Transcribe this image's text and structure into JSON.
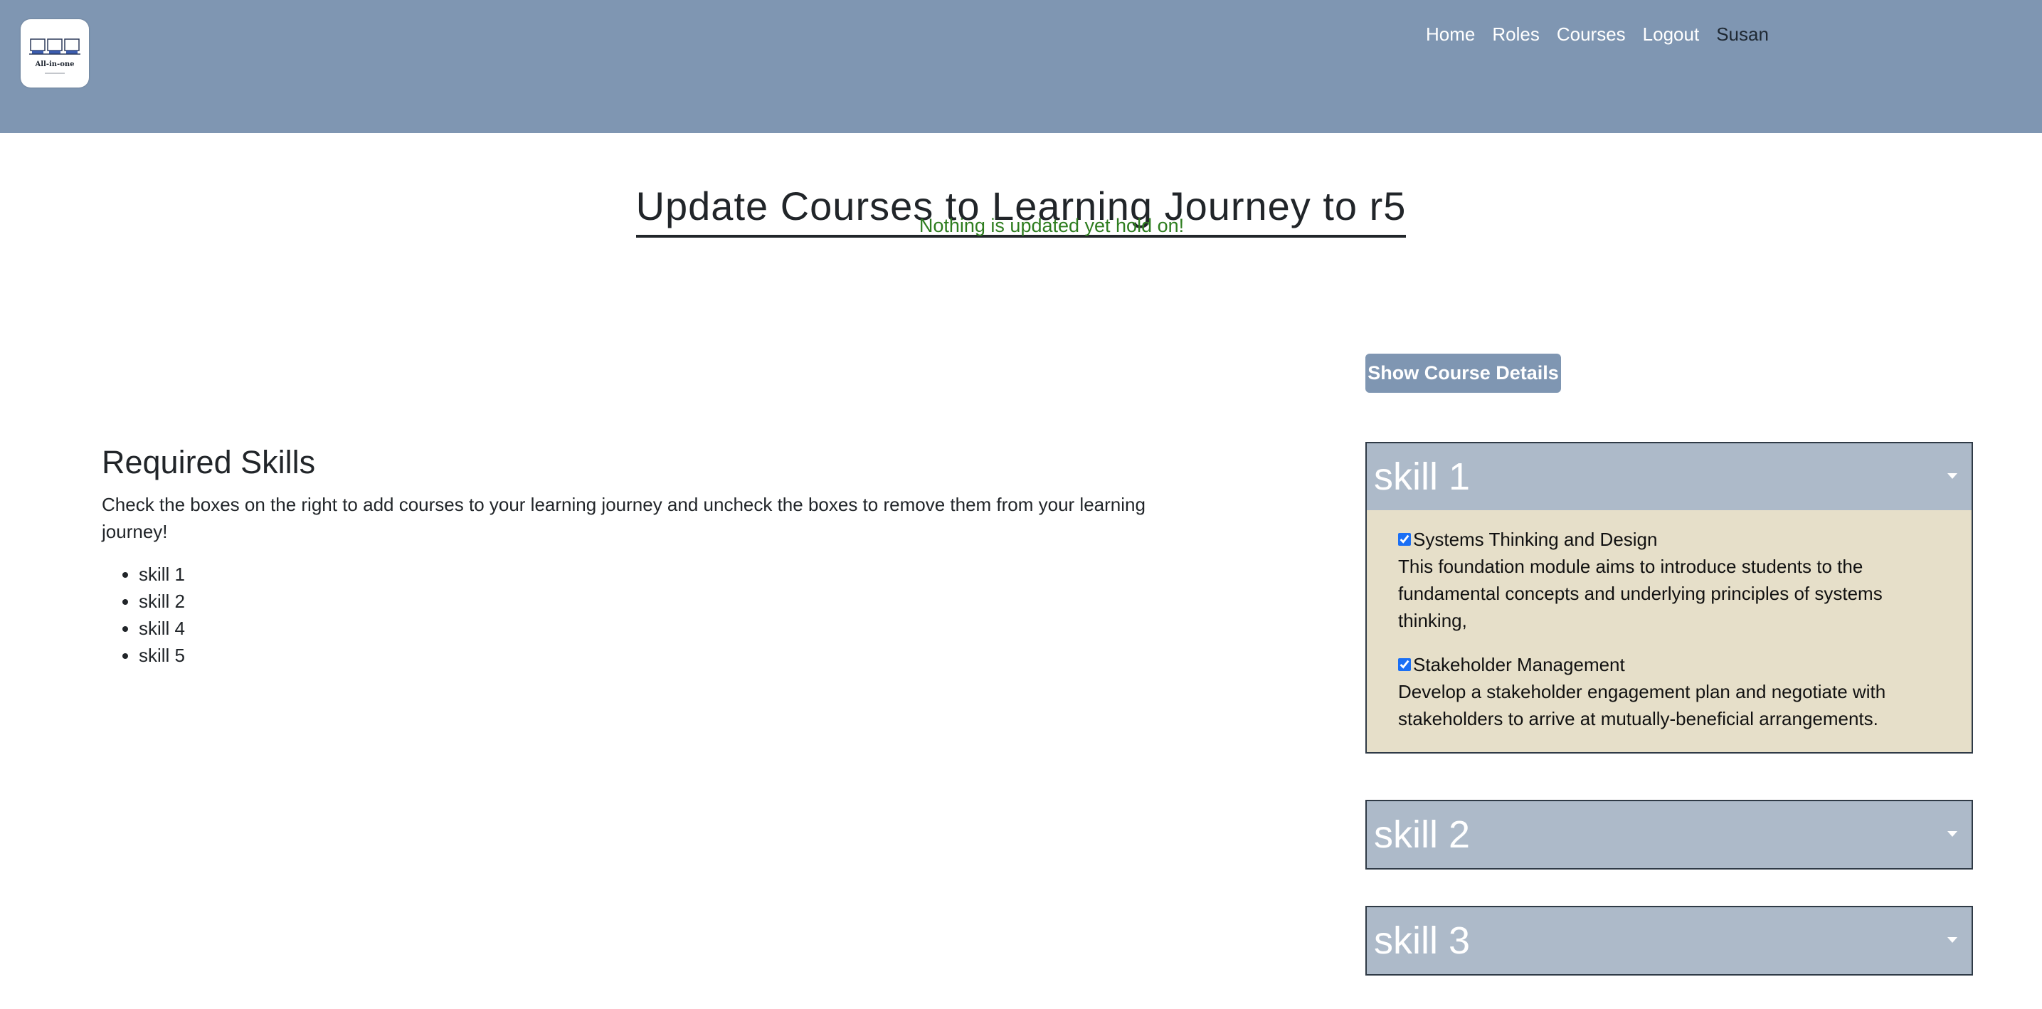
{
  "header": {
    "logo_text": "All-in-one",
    "nav": {
      "home": "Home",
      "roles": "Roles",
      "courses": "Courses",
      "logout": "Logout"
    },
    "user_name": "Susan",
    "colors": {
      "bar": "#7f96b2",
      "nav_text": "#ffffff"
    }
  },
  "page": {
    "title": "Update Courses to Learning Journey to r5",
    "status_message": "Nothing is updated yet hold on!",
    "status_color": "#2e7d1f"
  },
  "required_skills": {
    "heading": "Required Skills",
    "description": "Check the boxes on the right to add courses to your learning journey and uncheck the boxes to remove them from your learning journey!",
    "items": [
      "skill 1",
      "skill 2",
      "skill 4",
      "skill 5"
    ]
  },
  "course_panel": {
    "show_details_label": "Show Course Details",
    "skills": [
      {
        "name": "skill 1",
        "expanded": true,
        "courses": [
          {
            "title": "Systems Thinking and Design",
            "checked": true,
            "description": "This foundation module aims to introduce students to the fundamental concepts and underlying principles of systems thinking,"
          },
          {
            "title": "Stakeholder Management",
            "checked": true,
            "description": "Develop a stakeholder engagement plan and negotiate with stakeholders to arrive at mutually-beneficial arrangements."
          }
        ]
      },
      {
        "name": "skill 2",
        "expanded": false
      },
      {
        "name": "skill 3",
        "expanded": false
      }
    ],
    "colors": {
      "header_bg": "#adbac9",
      "body_bg": "#e6dfc9",
      "button_bg": "#7f96b2"
    }
  }
}
